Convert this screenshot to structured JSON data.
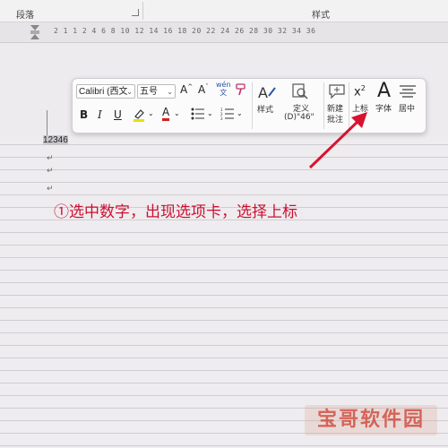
{
  "ribbon": {
    "group_paragraph": "段落",
    "group_styles": "样式"
  },
  "ruler": {
    "numbers": "2  1  1  2  4  6  8  10  12  14  16  18  20  22  24  26  28  30  32  34  36"
  },
  "document": {
    "selected_text": "12346",
    "lines_before_ruled": 3
  },
  "mini_toolbar": {
    "font_name": "Calibri (西文",
    "font_size": "五号",
    "grow_font": "A^",
    "shrink_font": "Aˇ",
    "phonetic": "wén\n文",
    "format_painter": "brush",
    "bold": "B",
    "italic": "I",
    "underline": "U",
    "highlight": "highlight",
    "font_color": "A",
    "bullets": "bullets",
    "numbering": "numbering",
    "styles_label": "样式",
    "define_label_1": "定义",
    "define_label_2": "(D)\"46\"",
    "new_comment_1": "新建",
    "new_comment_2": "批注",
    "superscript_label": "上标",
    "superscript_glyph": "x²",
    "font_label": "字体",
    "font_glyph": "A",
    "center_label": "居中"
  },
  "annotation": {
    "text": "①选中数字，出现选项卡，选择上标",
    "color": "#cc1030"
  },
  "watermark": {
    "text": "宝哥软件园"
  }
}
